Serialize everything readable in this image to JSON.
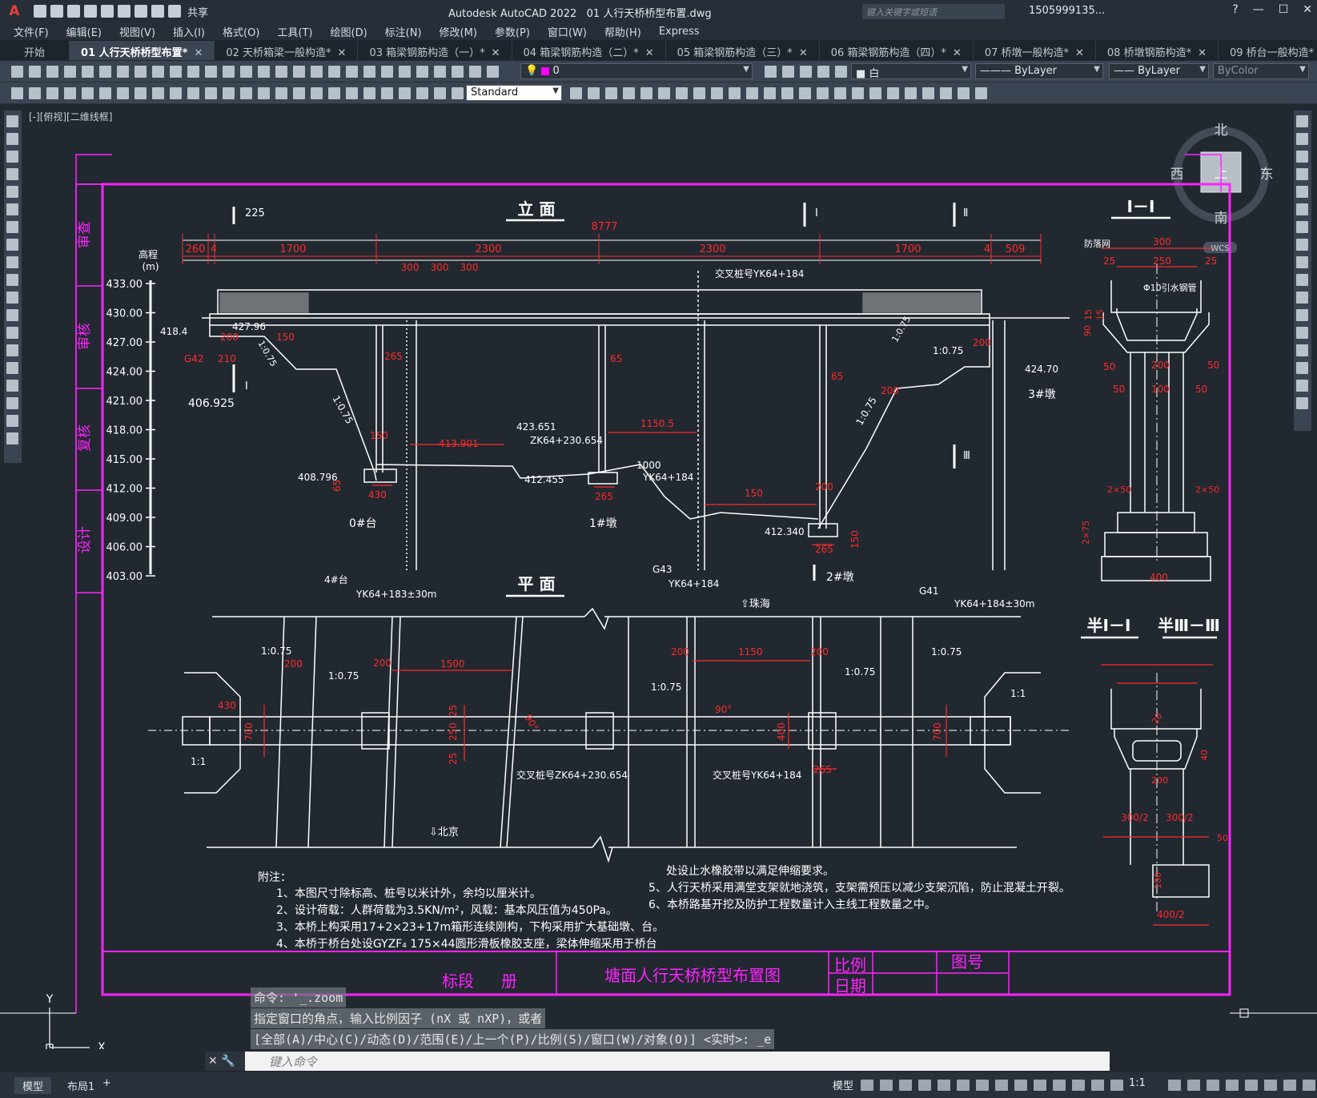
{
  "app": {
    "title": "Autodesk AutoCAD 2022",
    "file": "01 人行天桥桥型布置.dwg",
    "share_label": "共享",
    "search_placeholder": "键入关键字或短语",
    "user": "1505999135...",
    "help": "?"
  },
  "menu": [
    "文件(F)",
    "编辑(E)",
    "视图(V)",
    "插入(I)",
    "格式(O)",
    "工具(T)",
    "绘图(D)",
    "标注(N)",
    "修改(M)",
    "参数(P)",
    "窗口(W)",
    "帮助(H)",
    "Express"
  ],
  "tabs": [
    {
      "label": "开始",
      "kind": "start"
    },
    {
      "label": "01 人行天桥桥型布置*",
      "active": true
    },
    {
      "label": "02 天桥箱梁一般构造*"
    },
    {
      "label": "03 箱梁钢筋构造（一）*"
    },
    {
      "label": "04 箱梁钢筋构造（二）*"
    },
    {
      "label": "05 箱梁钢筋构造（三）*"
    },
    {
      "label": "06 箱梁钢筋构造（四）*"
    },
    {
      "label": "07 桥墩一般构造*"
    },
    {
      "label": "08 桥墩钢筋构造*"
    },
    {
      "label": "09 桥台一般构造*"
    }
  ],
  "toolbar": {
    "layer": "0",
    "color": "白",
    "linetype": "ByLayer",
    "lineweight": "ByLayer",
    "plotstyle": "ByColor",
    "textstyle": "Standard"
  },
  "viewport_label": "[-][俯视][二维线框]",
  "viewcube": {
    "north": "北",
    "south": "南",
    "east": "东",
    "west": "西",
    "top": "上",
    "wcs": "WCS"
  },
  "colors": {
    "magenta": "#ff22ff",
    "red": "#ff2a2a",
    "white": "#ffffff",
    "bg": "#212830"
  },
  "drawing": {
    "elevation_title": "立  面",
    "plan_title": "平  面",
    "sec1_title": "Ⅰ－Ⅰ",
    "sec2_title": "半Ⅰ－Ⅰ",
    "sec3_title": "半Ⅲ－Ⅲ",
    "elev_axis_label": "高程",
    "elev_axis_unit": "(m)",
    "elev_ticks": [
      "433.00",
      "430.00",
      "427.00",
      "424.00",
      "421.00",
      "418.00",
      "415.00",
      "412.00",
      "409.00",
      "406.00",
      "403.00"
    ],
    "dim_total": "8777",
    "dims_top": [
      "260",
      "4",
      "1700",
      "2300",
      "2300",
      "1700",
      "4",
      "509"
    ],
    "dims_300": [
      "300",
      "300",
      "300"
    ],
    "labels_elev": [
      "交叉桩号YK64+184",
      "427.96",
      "418.4",
      "1:0.75",
      "1:0.75",
      "1:0.75",
      "1:0.75",
      "1:0.75",
      "424.70",
      "423.651",
      "ZK64+230.654",
      "413.901",
      "1150.5",
      "1000",
      "YK64+184",
      "408.796",
      "412.455",
      "412.340",
      "406.925",
      "0#台",
      "1#墩",
      "2#墩",
      "3#墩",
      "4#台",
      "YK64+183±30m",
      "G43",
      "YK64+184",
      "G41",
      "YK64+184±30m",
      "G42",
      "210",
      "150",
      "200",
      "430",
      "265",
      "265",
      "265",
      "65",
      "65",
      "65",
      "150",
      "150",
      "150",
      "200",
      "200",
      "200",
      "225",
      "Ⅰ",
      "Ⅰ",
      "Ⅱ",
      "Ⅲ",
      "Ⅲ"
    ],
    "labels_plan": [
      "1:0.75",
      "1:0.75",
      "1:0.75",
      "1:0.75",
      "1:0.75",
      "200",
      "1500",
      "200",
      "1150",
      "200",
      "200",
      "430",
      "700",
      "250",
      "25",
      "25",
      "400",
      "700",
      "265",
      "90°",
      "交叉桩号ZK64+230.654",
      "交叉桩号YK64+184",
      "⇩北京",
      "⇧珠海",
      "1:1",
      "1:1",
      "90°"
    ],
    "labels_sec": [
      "防落网",
      "300",
      "250",
      "25",
      "25",
      "Φ10引水钢管",
      "15",
      "15",
      "90",
      "50",
      "200",
      "50",
      "50",
      "100",
      "50",
      "2×50",
      "2×50",
      "2×75",
      "400",
      "300/2",
      "300/2",
      "40",
      "50",
      "100",
      "400/2",
      "200",
      "20"
    ],
    "notes": {
      "title": "附注：",
      "lines": [
        "1、本图尺寸除标高、桩号以米计外，余均以厘米计。",
        "2、设计荷载：人群荷载为3.5KN/m²，风载：基本风压值为450Pa。",
        "3、本桥上构采用17+2×23+17m箱形连续刚构，下构采用扩大基础墩、台。",
        "4、本桥于桥台处设GYZF₄ 175×44圆形滑板橡胶支座，梁体伸缩采用于桥台"
      ],
      "lines_right": [
        "处设止水橡胶带以满足伸缩要求。",
        "5、人行天桥采用满堂支架就地浇筑，支架需预压以减少支架沉陷，防止混凝土开裂。",
        "6、本桥路基开挖及防护工程数量计入主线工程数量之中。"
      ]
    },
    "titleblock": {
      "section": "标段",
      "volume": "册",
      "drawing_name": "塘面人行天桥桥型布置图",
      "scale": "比例",
      "date": "日期",
      "drawing_no": "图号"
    },
    "sidebar": [
      "审查",
      "审核",
      "复核",
      "设计"
    ]
  },
  "command": {
    "history": [
      "命令: '_.zoom",
      "指定窗口的角点，输入比例因子 (nX 或 nXP)，或者",
      "[全部(A)/中心(C)/动态(D)/范围(E)/上一个(P)/比例(S)/窗口(W)/对象(O)] <实时>: _e"
    ],
    "placeholder": "键入命令"
  },
  "status": {
    "tabs": [
      "模型",
      "布局1"
    ],
    "model": "模型",
    "scale": "1:1"
  }
}
